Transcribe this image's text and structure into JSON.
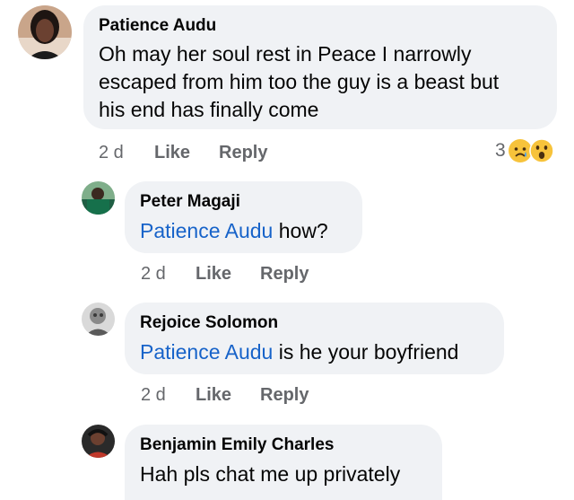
{
  "comments": [
    {
      "author": "Patience Audu",
      "text_lines": [
        "Oh may her soul rest in Peace I narrowly",
        "escaped from him too the guy is a beast but",
        "his end has finally come"
      ],
      "time": "2 d",
      "like_label": "Like",
      "reply_label": "Reply",
      "reaction_count": "3",
      "reaction_icons": [
        "sad-reaction-icon",
        "wow-reaction-icon"
      ]
    }
  ],
  "replies": [
    {
      "author": "Peter Magaji",
      "mention": "Patience Audu",
      "text": " how?",
      "time": "2 d",
      "like_label": "Like",
      "reply_label": "Reply"
    },
    {
      "author": "Rejoice Solomon",
      "mention": "Patience Audu",
      "text": " is he your boyfriend",
      "time": "2 d",
      "like_label": "Like",
      "reply_label": "Reply"
    },
    {
      "author": "Benjamin Emily Charles",
      "text": "Hah pls chat me up privately"
    }
  ],
  "colors": {
    "bubble": "#f0f2f5",
    "mention": "#1763c9",
    "meta": "#65676b",
    "text": "#050505"
  }
}
